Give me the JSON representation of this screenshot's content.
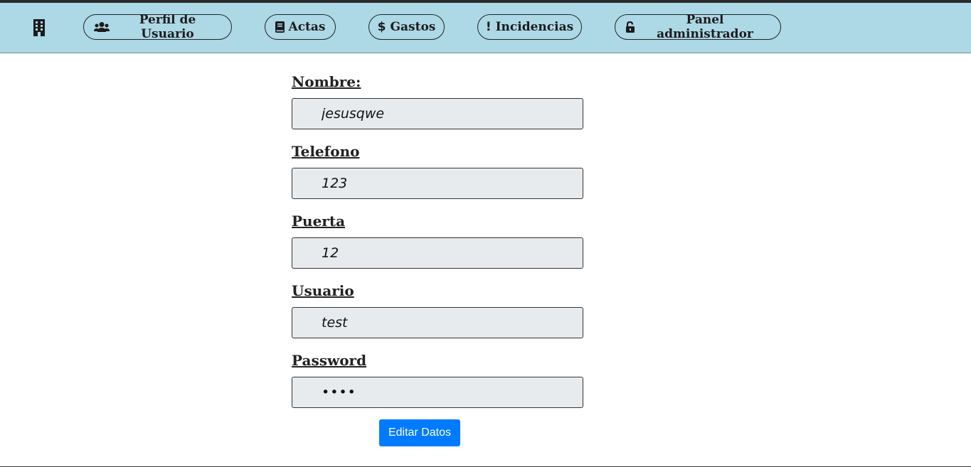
{
  "navbar": {
    "logo_icon": "building-icon",
    "items": [
      {
        "label": "Perfil de Usuario",
        "icon": "users-icon"
      },
      {
        "label": "Actas",
        "icon": "book-icon"
      },
      {
        "label": "Gastos",
        "icon": "dollar-icon"
      },
      {
        "label": "Incidencias",
        "icon": "exclamation-icon"
      },
      {
        "label": "Panel administrador",
        "icon": "unlock-icon"
      }
    ],
    "background": "#add8e6"
  },
  "form": {
    "nombre": {
      "label": "Nombre:",
      "value": "jesusqwe"
    },
    "telefono": {
      "label": "Telefono",
      "value": "123"
    },
    "puerta": {
      "label": "Puerta",
      "value": "12"
    },
    "usuario": {
      "label": "Usuario",
      "value": "test"
    },
    "password": {
      "label": "Password",
      "value": "••••"
    },
    "submit_label": "Editar Datos",
    "accent": "#007bff"
  }
}
